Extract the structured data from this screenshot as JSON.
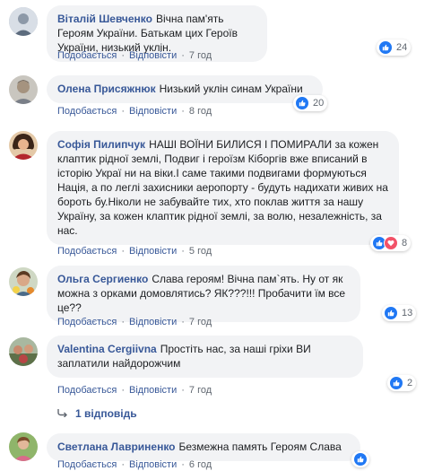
{
  "colors": {
    "link": "#385898",
    "bubble": "#f2f3f5",
    "like": "#2078f4",
    "love": "#f25268"
  },
  "actions": {
    "like_label": "Подобається",
    "reply_label": "Відповісти",
    "separator": "·"
  },
  "comments": [
    {
      "author": "Віталій Шевченко",
      "text": "Вічна пам'ять Героям України. Батькам цих Героїв України, низький уклін.",
      "time": "7 год",
      "reactions": {
        "icons": [
          "like-icon"
        ],
        "count": "24"
      }
    },
    {
      "author": "Олена Присяжнюк",
      "text": "Низький уклін синам України",
      "time": "8 год",
      "reactions": {
        "icons": [
          "like-icon"
        ],
        "count": "20"
      }
    },
    {
      "author": "Софія Пилипчук",
      "text": "НАШІ ВОЇНИ БИЛИСЯ І ПОМИРАЛИ за кожен клаптик рідної землі, Подвиг і героїзм Кіборгів вже вписаний в історію Украї ни на віки.І саме такими подвигами формуються Нація, а по леглі захисники аеропорту - будуть надихати живих на бороть бу.Ніколи не забувайте тих, хто поклав життя за нашу Україну, за кожен клаптик рідної землі, за волю, незалежність, за нас.",
      "time": "5 год",
      "reactions": {
        "icons": [
          "like-icon",
          "love-icon"
        ],
        "count": "8"
      }
    },
    {
      "author": "Ольга Сергиенко",
      "text": "Слава героям! Вічна пам`ять. Ну от як можна з орками домовлятись? ЯК???!!! Пробачити їм все це??",
      "time": "7 год",
      "reactions": {
        "icons": [
          "like-icon"
        ],
        "count": "13"
      }
    },
    {
      "author": "Valentina Cergiivna",
      "text": "Простіть нас, за наші гріхи ВИ заплатили найдорожчим",
      "time": "7 год",
      "reactions": {
        "icons": [
          "like-icon"
        ],
        "count": "2"
      },
      "replies_label": "1 відповідь"
    },
    {
      "author": "Светлана Лавриненко",
      "text": "Безмежна память Героям Слава",
      "time": "6 год",
      "reactions": {
        "icons": [
          "like-icon"
        ],
        "count": ""
      }
    }
  ]
}
